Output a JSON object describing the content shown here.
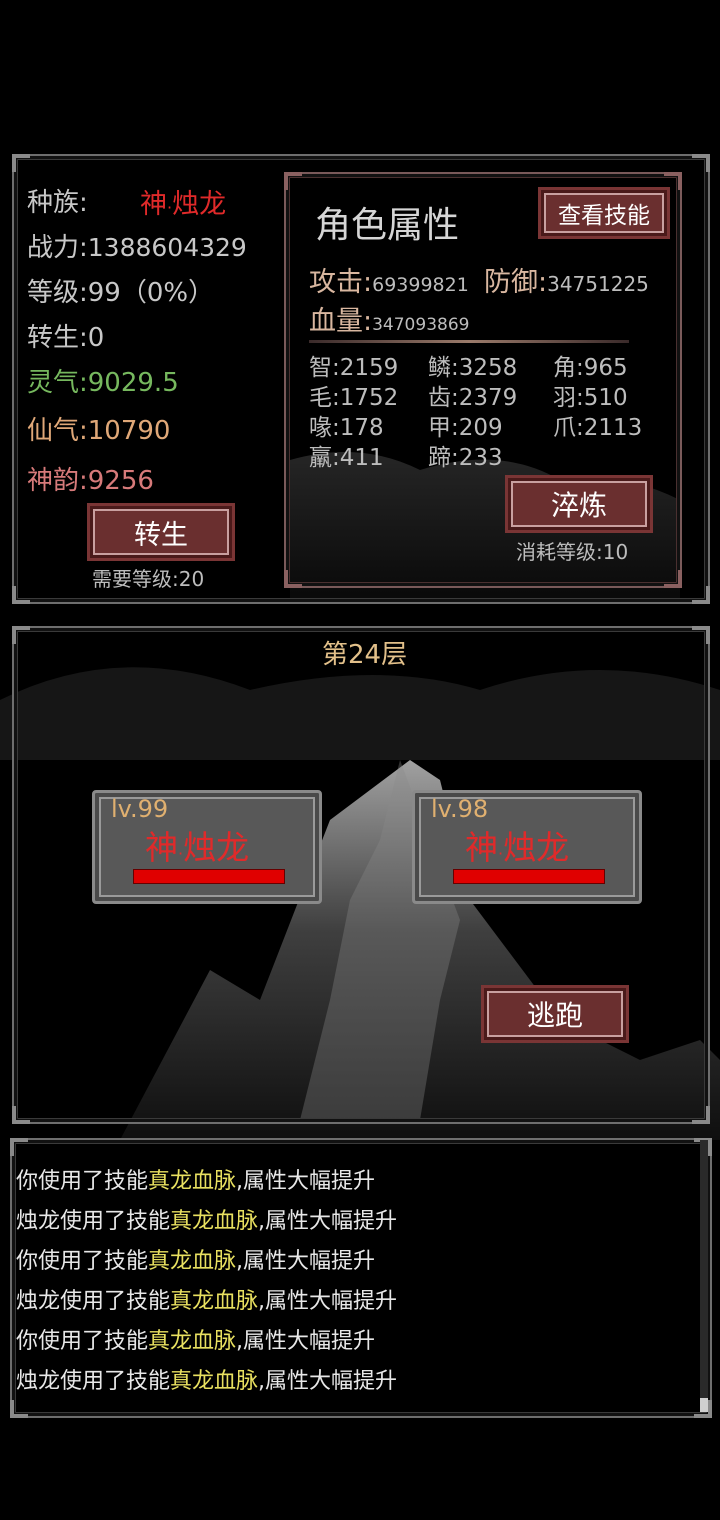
{
  "char": {
    "race_label": "种族:",
    "race_a": "神",
    "dot": "·",
    "race_b": "烛龙",
    "power_label": "战力:",
    "power": "1388604329",
    "level_label": "等级:",
    "level": "99（0%）",
    "rebirth_label": "转生:",
    "rebirth": "0",
    "spirit_label": "灵气:",
    "spirit": "9029.5",
    "immortal_label": "仙气:",
    "immortal": "10790",
    "divine_label": "神韵:",
    "divine": "9256",
    "rebirth_button": "转生",
    "rebirth_req": "需要等级:20"
  },
  "attrs": {
    "title": "角色属性",
    "skills_button": "查看技能",
    "atk_label": "攻击:",
    "atk": "69399821",
    "def_label": "防御:",
    "def": "34751225",
    "hp_label": "血量:",
    "hp": "347093869",
    "stats": [
      [
        "智:2159",
        "鳞:3258",
        "角:965"
      ],
      [
        "毛:1752",
        "齿:2379",
        "羽:510"
      ],
      [
        "喙:178",
        "甲:209",
        "爪:2113"
      ],
      [
        "羸:411",
        "蹄:233",
        ""
      ]
    ],
    "temper_button": "淬炼",
    "temper_cost": "消耗等级:10"
  },
  "battle": {
    "floor": "第24层",
    "player": {
      "level": "lv.99",
      "name_a": "神",
      "dot": "·",
      "name_b": "烛龙",
      "hp_fraction": 1.0
    },
    "enemy": {
      "level": "lv.98",
      "name_a": "神",
      "dot": "·",
      "name_b": "烛龙",
      "hp_fraction": 1.0
    },
    "flee_button": "逃跑"
  },
  "log": [
    {
      "pre": "你使用了技能",
      "skill": "真龙血脉",
      "post": ",属性大幅提升"
    },
    {
      "pre": "烛龙使用了技能",
      "skill": "真龙血脉",
      "post": ",属性大幅提升"
    },
    {
      "pre": "你使用了技能",
      "skill": "真龙血脉",
      "post": ",属性大幅提升"
    },
    {
      "pre": "烛龙使用了技能",
      "skill": "真龙血脉",
      "post": ",属性大幅提升"
    },
    {
      "pre": "你使用了技能",
      "skill": "真龙血脉",
      "post": ",属性大幅提升"
    },
    {
      "pre": "烛龙使用了技能",
      "skill": "真龙血脉",
      "post": ",属性大幅提升"
    }
  ],
  "colors": {
    "accent_red": "#e02a2a",
    "skill_yellow": "#e8e060",
    "button_maroon": "#6a2f2f"
  }
}
